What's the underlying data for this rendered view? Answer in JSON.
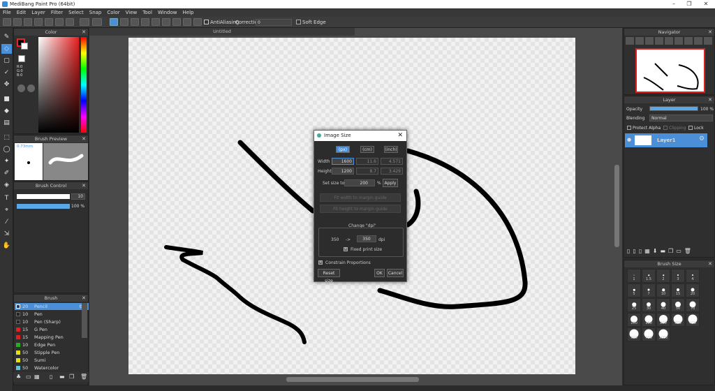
{
  "window": {
    "title": "MediBang Paint Pro (64bit)"
  },
  "menu": [
    "File",
    "Edit",
    "Layer",
    "Filter",
    "Select",
    "Snap",
    "Color",
    "View",
    "Tool",
    "Window",
    "Help"
  ],
  "toolbar": {
    "antialiasing_label": "AntiAliasing",
    "correction_label": "Correction",
    "correction_value": "0",
    "soft_edge_label": "Soft Edge"
  },
  "color_panel": {
    "title": "Color",
    "r": "R:0",
    "g": "G:0",
    "b": "B:0"
  },
  "brush_preview": {
    "title": "Brush Preview",
    "size_text": "0.73mm"
  },
  "brush_control": {
    "title": "Brush Control",
    "size_value": "10",
    "opacity_value": "100 %"
  },
  "brush_panel": {
    "title": "Brush",
    "items": [
      {
        "size": "20",
        "name": "Pencil",
        "color": "#1f3a6a"
      },
      {
        "size": "10",
        "name": "Pen",
        "color": "#222222"
      },
      {
        "size": "10",
        "name": "Pen (Sharp)",
        "color": "#222222"
      },
      {
        "size": "15",
        "name": "G Pen",
        "color": "#e02020"
      },
      {
        "size": "15",
        "name": "Mapping Pen",
        "color": "#e02020"
      },
      {
        "size": "10",
        "name": "Edge Pen",
        "color": "#20b020"
      },
      {
        "size": "50",
        "name": "Stipple Pen",
        "color": "#e0e020"
      },
      {
        "size": "50",
        "name": "Sumi",
        "color": "#e0e020"
      },
      {
        "size": "50",
        "name": "Watercolor",
        "color": "#60c0e0"
      }
    ]
  },
  "canvas": {
    "tab": "Untitled"
  },
  "dialog": {
    "title": "Image Size",
    "units": [
      "(px)",
      "(cm)",
      "(inch)"
    ],
    "width_label": "Width",
    "width_px": "1600",
    "width_cm": "11.6",
    "width_inch": "4.571",
    "height_label": "Height",
    "height_px": "1200",
    "height_cm": "8.7",
    "height_inch": "3.429",
    "set_size_label": "Set size to",
    "set_size_value": "200",
    "percent": "%",
    "apply": "Apply",
    "fit_width": "Fit width to margin guide",
    "fit_height": "Fit height to margin guide",
    "change_dpi_label": "Change \"dpi\"",
    "dpi_from": "350",
    "arrow": "->",
    "dpi_to": "350",
    "dpi_unit": "dpi",
    "fixed_print_size": "Fixed print size",
    "constrain": "Constrain Proportions",
    "reset": "Reset size",
    "ok": "OK",
    "cancel": "Cancel"
  },
  "navigator": {
    "title": "Navigator"
  },
  "layer_panel": {
    "title": "Layer",
    "opacity_label": "Opacity",
    "opacity_value": "100 %",
    "opacity_fraction": 1.0,
    "blending_label": "Blending",
    "blending_value": "Normal",
    "protect_alpha": "Protect Alpha",
    "clipping": "Clipping",
    "lock": "Lock",
    "layer_name": "Layer1"
  },
  "brush_size_panel": {
    "title": "Brush Size",
    "sizes": [
      "1",
      "1.5",
      "2",
      "3",
      "4",
      "5",
      "7",
      "10",
      "15",
      "20",
      "25",
      "30",
      "40",
      "50",
      "70",
      "100",
      "150",
      "200",
      "300",
      "400",
      "500",
      "700",
      "1000"
    ]
  }
}
